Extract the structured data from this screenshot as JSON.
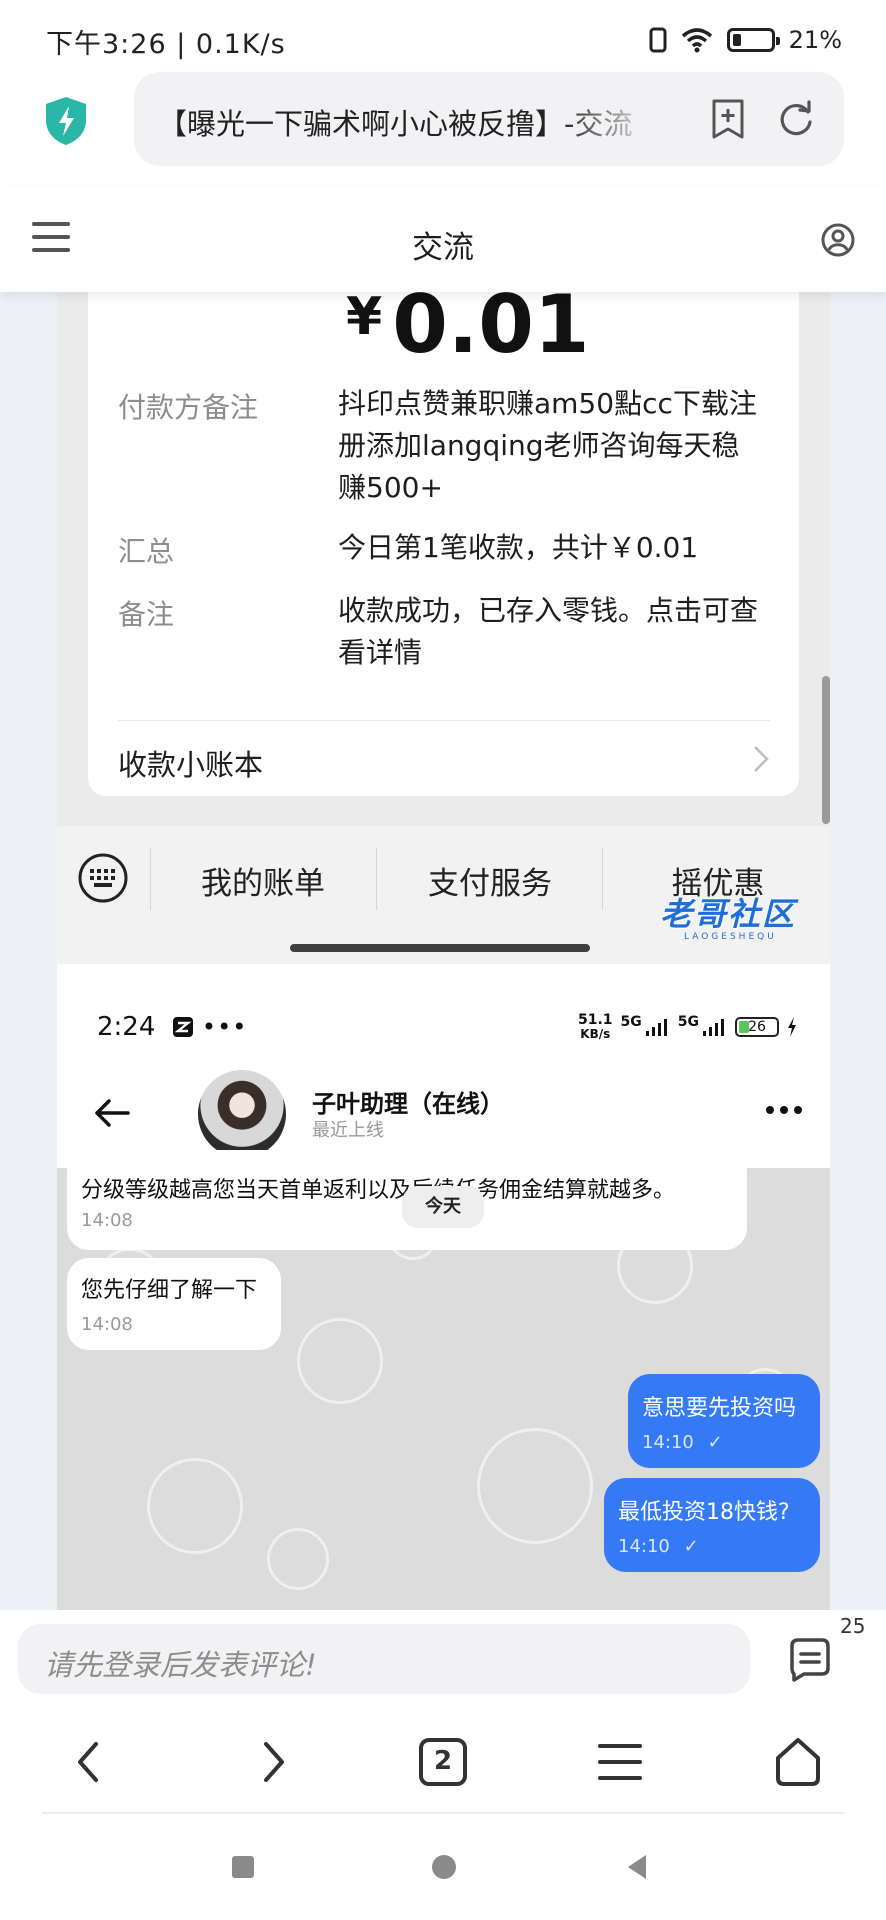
{
  "status_bar": {
    "time_speed": "下午3:26 | 0.1K/s",
    "battery": "21%",
    "battery_level": 0.21
  },
  "browser": {
    "address_text": "【曝光一下骗术啊小心被反撸】-交流"
  },
  "site": {
    "title": "交流"
  },
  "receipt": {
    "currency": "¥",
    "amount": "0.01",
    "rows": [
      {
        "label": "付款方备注",
        "value": "抖印点赞兼职赚am50點cc下载注册添加langqing老师咨询每天稳赚500+"
      },
      {
        "label": "汇总",
        "value": "今日第1笔收款，共计￥0.01"
      },
      {
        "label": "备注",
        "value": "收款成功，已存入零钱。点击可查看详情"
      }
    ],
    "book_label": "收款小账本"
  },
  "wallet_tabs": [
    "我的账单",
    "支付服务",
    "摇优惠"
  ],
  "watermark": {
    "title": "老哥社区",
    "subtitle": "LAOGESHEQU"
  },
  "phone": {
    "time": "2:24",
    "net_speed_value": "51.1",
    "net_speed_unit": "KB/s",
    "signal1": "5G",
    "signal2": "5G",
    "battery": "26",
    "battery_level": 0.26
  },
  "chat": {
    "contact_name": "子叶助理（在线）",
    "contact_status": "最近上线",
    "today_label": "今天",
    "messages": [
      {
        "dir": "in",
        "text": "分级等级越高您当天首单返利以及后续任务佣金结算就越多。",
        "time": "14:08"
      },
      {
        "dir": "in",
        "text": "您先仔细了解一下",
        "time": "14:08"
      },
      {
        "dir": "out",
        "text": "意思要先投资吗",
        "time": "14:10",
        "check": "✓"
      },
      {
        "dir": "out",
        "text": "最低投资18快钱?",
        "time": "14:10",
        "check": "✓"
      }
    ]
  },
  "comment": {
    "placeholder": "请先登录后发表评论!",
    "count": "25"
  },
  "bottom_nav": {
    "tab_count": "2"
  },
  "colors": {
    "accent_blue": "#3579f5",
    "shield_teal": "#2bb7a8",
    "watermark_blue": "#1f6fd8"
  }
}
